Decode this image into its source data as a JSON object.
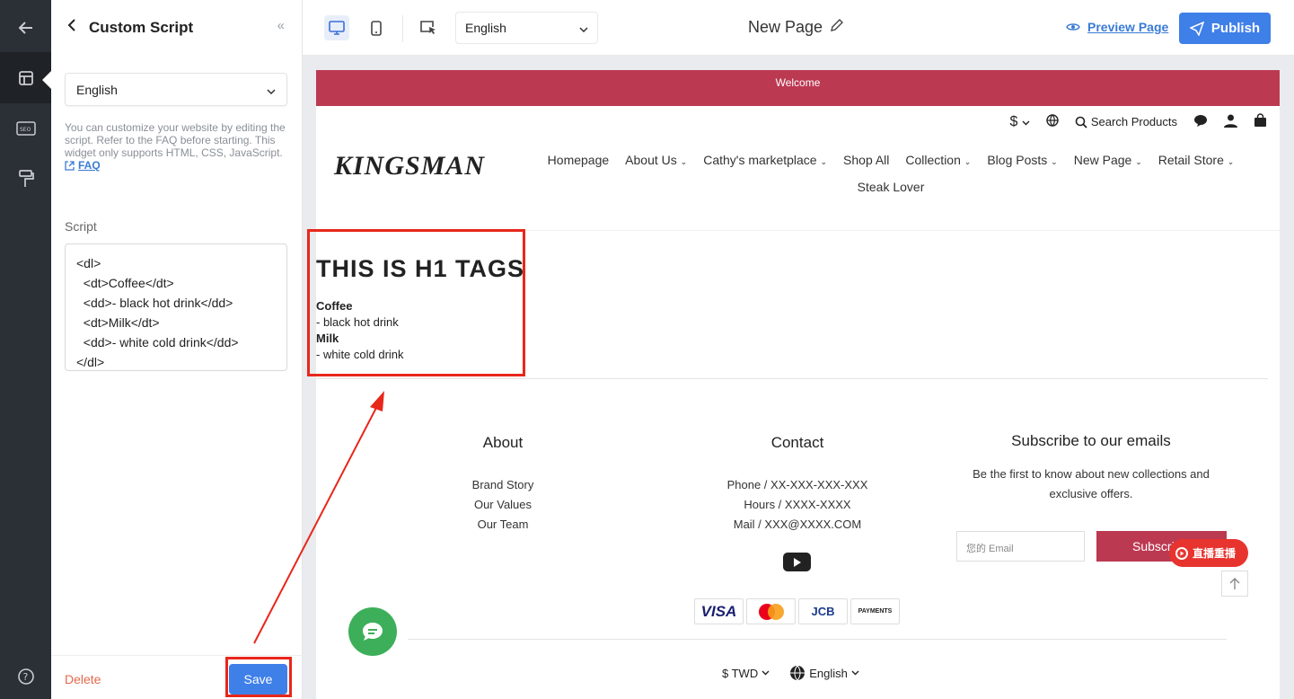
{
  "panel": {
    "title": "Custom Script",
    "language": "English",
    "help_text": "You can customize your website by editing the script. Refer to the FAQ before starting. This widget only supports HTML, CSS, JavaScript.",
    "faq_label": "FAQ",
    "script_label": "Script",
    "script_value": "<dl>\n  <dt>Coffee</dt>\n  <dd>- black hot drink</dd>\n  <dt>Milk</dt>\n  <dd>- white cold drink</dd>\n</dl>",
    "delete_label": "Delete",
    "save_label": "Save"
  },
  "topbar": {
    "language": "English",
    "page_title": "New Page",
    "preview_label": "Preview Page",
    "publish_label": "Publish"
  },
  "site": {
    "announcement": "Welcome",
    "currency_symbol": "$",
    "search_label": "Search Products",
    "logo": "KINGSMAN",
    "nav": [
      "Homepage",
      "About Us",
      "Cathy's marketplace",
      "Shop All",
      "Collection",
      "Blog Posts",
      "New Page",
      "Retail Store",
      "Steak Lover"
    ],
    "heading": "THIS IS H1 TAGS",
    "definitions": [
      {
        "term": "Coffee",
        "desc": "- black hot drink"
      },
      {
        "term": "Milk",
        "desc": "- white cold drink"
      }
    ],
    "footer": {
      "about_title": "About",
      "about_links": [
        "Brand Story",
        "Our Values",
        "Our Team"
      ],
      "contact_title": "Contact",
      "contact_lines": [
        "Phone / XX-XXX-XXX-XXX",
        "Hours / XXXX-XXXX",
        "Mail / XXX@XXXX.COM"
      ],
      "subscribe_title": "Subscribe to our emails",
      "subscribe_text": "Be the first to know about new collections and exclusive offers.",
      "email_placeholder": "您的 Email",
      "subscribe_button": "Subscri",
      "live_label": "直播重播",
      "payments": [
        "VISA",
        "",
        "JCB",
        "PAYMENTS"
      ],
      "currency": "$ TWD",
      "language": "English"
    }
  },
  "colors": {
    "accent": "#3f7fe8",
    "brand": "#bc3952",
    "highlight": "#e8271b",
    "rail": "#2b2f36",
    "chat": "#3daf5a"
  }
}
